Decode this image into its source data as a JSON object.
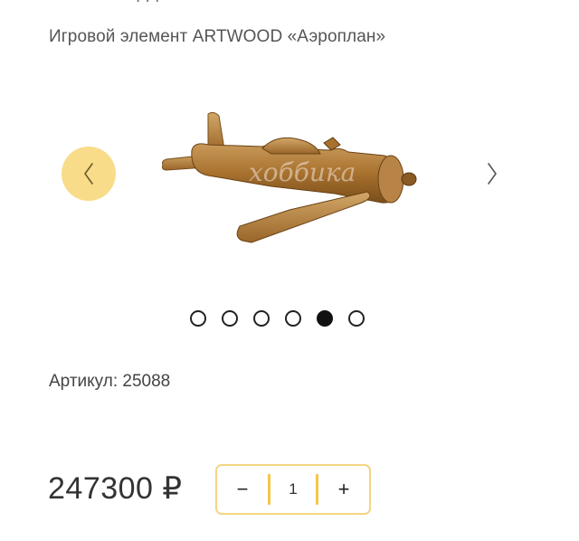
{
  "product": {
    "title": "Игровой элемент ARTWOOD «Аэроплан»",
    "article": "Артикул: 25088",
    "price": "247300 ₽",
    "quantity": "1"
  },
  "gallery": {
    "slide_count": 6,
    "active_index": 4,
    "watermark": "хоббика"
  },
  "quantity_control": {
    "minus_label": "−",
    "plus_label": "+"
  },
  "colors": {
    "accent_yellow": "#f8dc8a",
    "border_yellow": "#f3d583",
    "wood": "#b07a3a"
  }
}
